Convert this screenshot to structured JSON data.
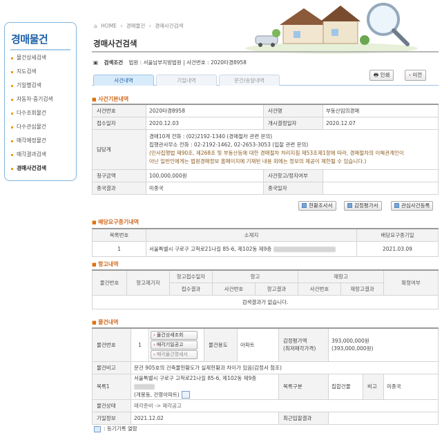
{
  "sidebar": {
    "title": "경매물건",
    "items": [
      "물건상세검색",
      "지도검색",
      "기일별검색",
      "자동차·중기검색",
      "다수조회물건",
      "다수관심물건",
      "매각예정물건",
      "매각결과검색",
      "경매사건검색"
    ]
  },
  "breadcrumb": {
    "home": "HOME",
    "level1": "경매물건",
    "level2": "경매사건검색"
  },
  "page_title": "경매사건검색",
  "condition": {
    "label": "검색조건",
    "text": "법원 : 서울남부지방법원 | 사건번호 : 2020타경8958"
  },
  "buttons": {
    "print": "인쇄",
    "prev": "이전",
    "survey": "현황조사서",
    "appraisal": "감정평가서",
    "related": "관심사건등록",
    "detail": "물건상세조회",
    "schedule": "매각기일공고",
    "spec": "매각물건명세서"
  },
  "tabs": [
    "사건내역",
    "기일내역",
    "문건/송달내역"
  ],
  "basic": {
    "header": "사건기본내역",
    "case_no_label": "사건번호",
    "case_no": "2020타경8958",
    "case_name_label": "사건명",
    "case_name": "부동산임의경매",
    "recv_label": "접수일자",
    "recv": "2020.12.03",
    "start_label": "개시결정일자",
    "start": "2020.12.07",
    "dept_label": "담당계",
    "dept1": "경매10계   전화 : (02)2192-1340 (경매절차 관련 문의)",
    "dept2": "집행관사무소   전화 : 02-2192-1462, 02-2653-3053 (입찰 관련 문의)",
    "dept3": "(민사집행법 제90조, 제268조 및 부동산등에 대한 경매절차 처리지침 제53조제1항에 따라, 경매절차의 이해관계인이",
    "dept4": "아닌 일반인에게는 법원경매정보 홈페이지에 기재된 내용 외에는 정보의 제공이 제한될 수 있습니다.)",
    "claim_label": "청구금액",
    "claim": "100,000,000원",
    "stop_label": "사건항고/정지여부",
    "stop": "",
    "result_label": "종국결과",
    "result": "미종국",
    "end_label": "종국일자",
    "end": ""
  },
  "dist": {
    "header": "배당요구종기내역",
    "cols": [
      "목록번호",
      "소재지",
      "배당요구종기일"
    ],
    "row": {
      "no": "1",
      "addr": "서울특별시 구로구 고척로21나길 85-6, 제102동 제9층",
      "date": "2021.03.09"
    }
  },
  "appeal": {
    "header": "항고내역",
    "col_item": "물건번호",
    "col_filer": "항고제기자",
    "col_recv": "항고접수일자",
    "col_recv_sub": "접수결과",
    "col_appeal": "항고",
    "col_reappeal": "재항고",
    "col_case": "사건번호",
    "col_result": "항고결과",
    "col_rcase": "사건번호",
    "col_rresult": "재항고결과",
    "col_final": "확정여부",
    "empty": "검색결과가 없습니다."
  },
  "item": {
    "header": "물건내역",
    "no_label": "물건번호",
    "no": "1",
    "use_label": "물건용도",
    "use": "아파트",
    "value_label": "감정평가액",
    "value_sub": "(최저매각가격)",
    "value": "393,000,000원",
    "value_min": "(393,000,000원)",
    "remark_label": "물건비고",
    "remark": "문건 905호의 건축물현황도가 실제현황과 차이가 있음(감정서 첨조)",
    "list_label": "목록1",
    "addr1": "서울특별시 구로구 고척로21나길 85-6, 제102동 제9층",
    "addr2": "(개봉동, 건영아파트)",
    "kind_label": "목록구분",
    "kind": "집합건물",
    "bigo_label": "비고",
    "bigo": "미종국",
    "status_label": "물건상태",
    "status": "매각준비 -> 매각공고",
    "date_label": "기일정보",
    "date": "2021.12.02",
    "last_label": "최근입찰결과",
    "last": ""
  },
  "footer": {
    "text": ": 등기기록 열람"
  }
}
